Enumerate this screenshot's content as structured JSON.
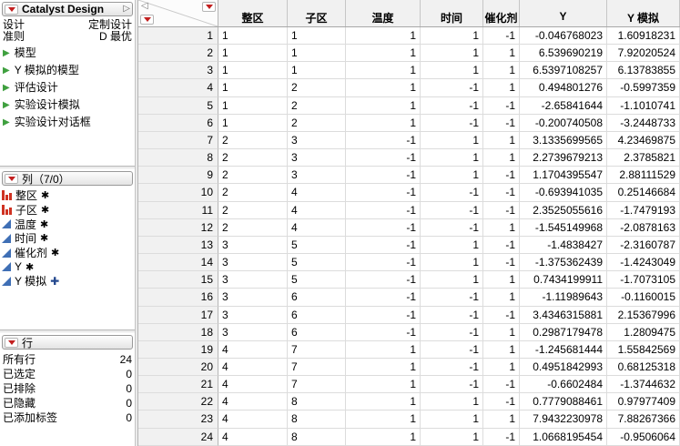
{
  "colors": {
    "accent_red": "#c21f1f",
    "nominal_red": "#cf3222",
    "continuous_blue": "#3f6fb5",
    "formula_blue": "#24488e",
    "green_arrow": "#3fa03f"
  },
  "sidebar": {
    "design_panel": {
      "title": "Catalyst Design",
      "expand_icon": "▷",
      "properties": [
        {
          "label": "设计",
          "value": "定制设计"
        },
        {
          "label": "准则",
          "value": "D 最优"
        }
      ],
      "items": [
        "模型",
        "Y 模拟的模型",
        "评估设计",
        "实验设计模拟",
        "实验设计对话框"
      ]
    },
    "columns_panel": {
      "title": "列（7/0）",
      "items": [
        {
          "name": "整区",
          "icon": "nominal",
          "badge": "✱"
        },
        {
          "name": "子区",
          "icon": "nominal",
          "badge": "✱"
        },
        {
          "name": "温度",
          "icon": "continuous",
          "badge": "✱"
        },
        {
          "name": "时间",
          "icon": "continuous",
          "badge": "✱"
        },
        {
          "name": "催化剂",
          "icon": "continuous",
          "badge": "✱"
        },
        {
          "name": "Y",
          "icon": "continuous",
          "badge": "✱"
        },
        {
          "name": "Y 模拟",
          "icon": "continuous",
          "badge": "✚"
        }
      ]
    },
    "rows_panel": {
      "title": "行",
      "stats": [
        {
          "label": "所有行",
          "value": "24"
        },
        {
          "label": "已选定",
          "value": "0"
        },
        {
          "label": "已排除",
          "value": "0"
        },
        {
          "label": "已隐藏",
          "value": "0"
        },
        {
          "label": "已添加标签",
          "value": "0"
        }
      ]
    }
  },
  "table": {
    "columns": [
      "整区",
      "子区",
      "温度",
      "时间",
      "催化剂",
      "Y",
      "Y 模拟"
    ],
    "rows": [
      [
        "1",
        "1",
        "1",
        "1",
        "1",
        "-1",
        "-0.046768023",
        "1.60918231"
      ],
      [
        "2",
        "1",
        "1",
        "1",
        "1",
        "1",
        "6.539690219",
        "7.92020524"
      ],
      [
        "3",
        "1",
        "1",
        "1",
        "1",
        "1",
        "6.5397108257",
        "6.13783855"
      ],
      [
        "4",
        "1",
        "2",
        "1",
        "-1",
        "1",
        "0.494801276",
        "-0.5997359"
      ],
      [
        "5",
        "1",
        "2",
        "1",
        "-1",
        "-1",
        "-2.65841644",
        "-1.1010741"
      ],
      [
        "6",
        "1",
        "2",
        "1",
        "-1",
        "-1",
        "-0.200740508",
        "-3.2448733"
      ],
      [
        "7",
        "2",
        "3",
        "-1",
        "1",
        "1",
        "3.1335699565",
        "4.23469875"
      ],
      [
        "8",
        "2",
        "3",
        "-1",
        "1",
        "1",
        "2.2739679213",
        "2.3785821"
      ],
      [
        "9",
        "2",
        "3",
        "-1",
        "1",
        "-1",
        "1.1704395547",
        "2.88111529"
      ],
      [
        "10",
        "2",
        "4",
        "-1",
        "-1",
        "-1",
        "-0.693941035",
        "0.25146684"
      ],
      [
        "11",
        "2",
        "4",
        "-1",
        "-1",
        "-1",
        "2.3525055616",
        "-1.7479193"
      ],
      [
        "12",
        "2",
        "4",
        "-1",
        "-1",
        "1",
        "-1.545149968",
        "-2.0878163"
      ],
      [
        "13",
        "3",
        "5",
        "-1",
        "1",
        "-1",
        "-1.4838427",
        "-2.3160787"
      ],
      [
        "14",
        "3",
        "5",
        "-1",
        "1",
        "-1",
        "-1.375362439",
        "-1.4243049"
      ],
      [
        "15",
        "3",
        "5",
        "-1",
        "1",
        "1",
        "0.7434199911",
        "-1.7073105"
      ],
      [
        "16",
        "3",
        "6",
        "-1",
        "-1",
        "1",
        "-1.11989643",
        "-0.1160015"
      ],
      [
        "17",
        "3",
        "6",
        "-1",
        "-1",
        "-1",
        "3.4346315881",
        "2.15367996"
      ],
      [
        "18",
        "3",
        "6",
        "-1",
        "-1",
        "1",
        "0.2987179478",
        "1.2809475"
      ],
      [
        "19",
        "4",
        "7",
        "1",
        "-1",
        "1",
        "-1.245681444",
        "1.55842569"
      ],
      [
        "20",
        "4",
        "7",
        "1",
        "-1",
        "1",
        "0.4951842993",
        "0.68125318"
      ],
      [
        "21",
        "4",
        "7",
        "1",
        "-1",
        "-1",
        "-0.6602484",
        "-1.3744632"
      ],
      [
        "22",
        "4",
        "8",
        "1",
        "1",
        "-1",
        "0.7779088461",
        "0.97977409"
      ],
      [
        "23",
        "4",
        "8",
        "1",
        "1",
        "1",
        "7.9432230978",
        "7.88267366"
      ],
      [
        "24",
        "4",
        "8",
        "1",
        "1",
        "-1",
        "1.0668195454",
        "-0.9506064"
      ]
    ]
  }
}
